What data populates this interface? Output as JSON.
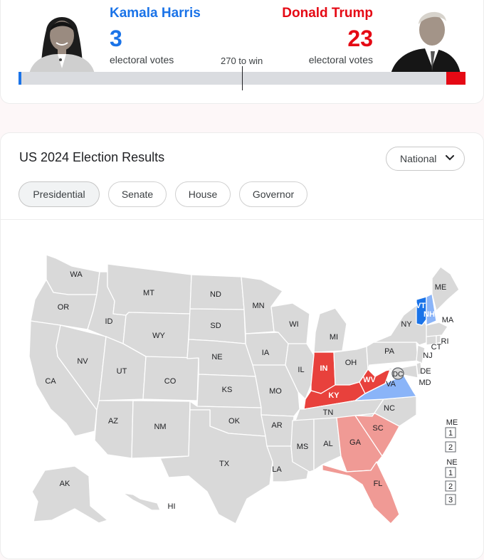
{
  "scoreboard": {
    "harris": {
      "name": "Kamala Harris",
      "votes": "3",
      "label": "electoral votes",
      "share": 0.0056,
      "color": "#1a73e8"
    },
    "trump": {
      "name": "Donald Trump",
      "votes": "23",
      "label": "electoral votes",
      "share": 0.0427,
      "color": "#e50914"
    },
    "to_win": "270 to win"
  },
  "results": {
    "title": "US 2024 Election Results",
    "dropdown": "National",
    "tabs": [
      "Presidential",
      "Senate",
      "House",
      "Governor"
    ],
    "active_tab": "Presidential"
  },
  "map": {
    "colors": {
      "none": "#d9d9d9",
      "dem": "#1a73e8",
      "lean_dem": "#8ab4f8",
      "rep": "#e8413c",
      "lean_rep": "#f09a95"
    },
    "states": {
      "WA": "WA",
      "OR": "OR",
      "CA": "CA",
      "ID": "ID",
      "NV": "NV",
      "MT": "MT",
      "WY": "WY",
      "UT": "UT",
      "AZ": "AZ",
      "CO": "CO",
      "NM": "NM",
      "ND": "ND",
      "SD": "SD",
      "NE": "NE",
      "KS": "KS",
      "OK": "OK",
      "TX": "TX",
      "MN": "MN",
      "IA": "IA",
      "MO": "MO",
      "AR": "AR",
      "LA": "LA",
      "WI": "WI",
      "IL": "IL",
      "MI": "MI",
      "IN": "IN",
      "OH": "OH",
      "KY": "KY",
      "TN": "TN",
      "MS": "MS",
      "AL": "AL",
      "GA": "GA",
      "FL": "FL",
      "SC": "SC",
      "NC": "NC",
      "VA": "VA",
      "WV": "WV",
      "PA": "PA",
      "NY": "NY",
      "NJ": "NJ",
      "DE": "DE",
      "MD": "MD",
      "DC": "DC",
      "CT": "CT",
      "RI": "RI",
      "MA": "MA",
      "VT": "VT",
      "NH": "NH",
      "ME": "ME",
      "AK": "AK",
      "HI": "HI"
    },
    "called": {
      "VT": "dem",
      "NH": "lean_dem",
      "VA": "lean_dem",
      "IN": "rep",
      "KY": "rep",
      "WV": "rep",
      "SC": "lean_rep",
      "GA": "lean_rep",
      "FL": "lean_rep"
    },
    "districts": {
      "me_label": "ME",
      "me": [
        "1",
        "2"
      ],
      "ne_label": "NE",
      "ne": [
        "1",
        "2",
        "3"
      ]
    }
  }
}
